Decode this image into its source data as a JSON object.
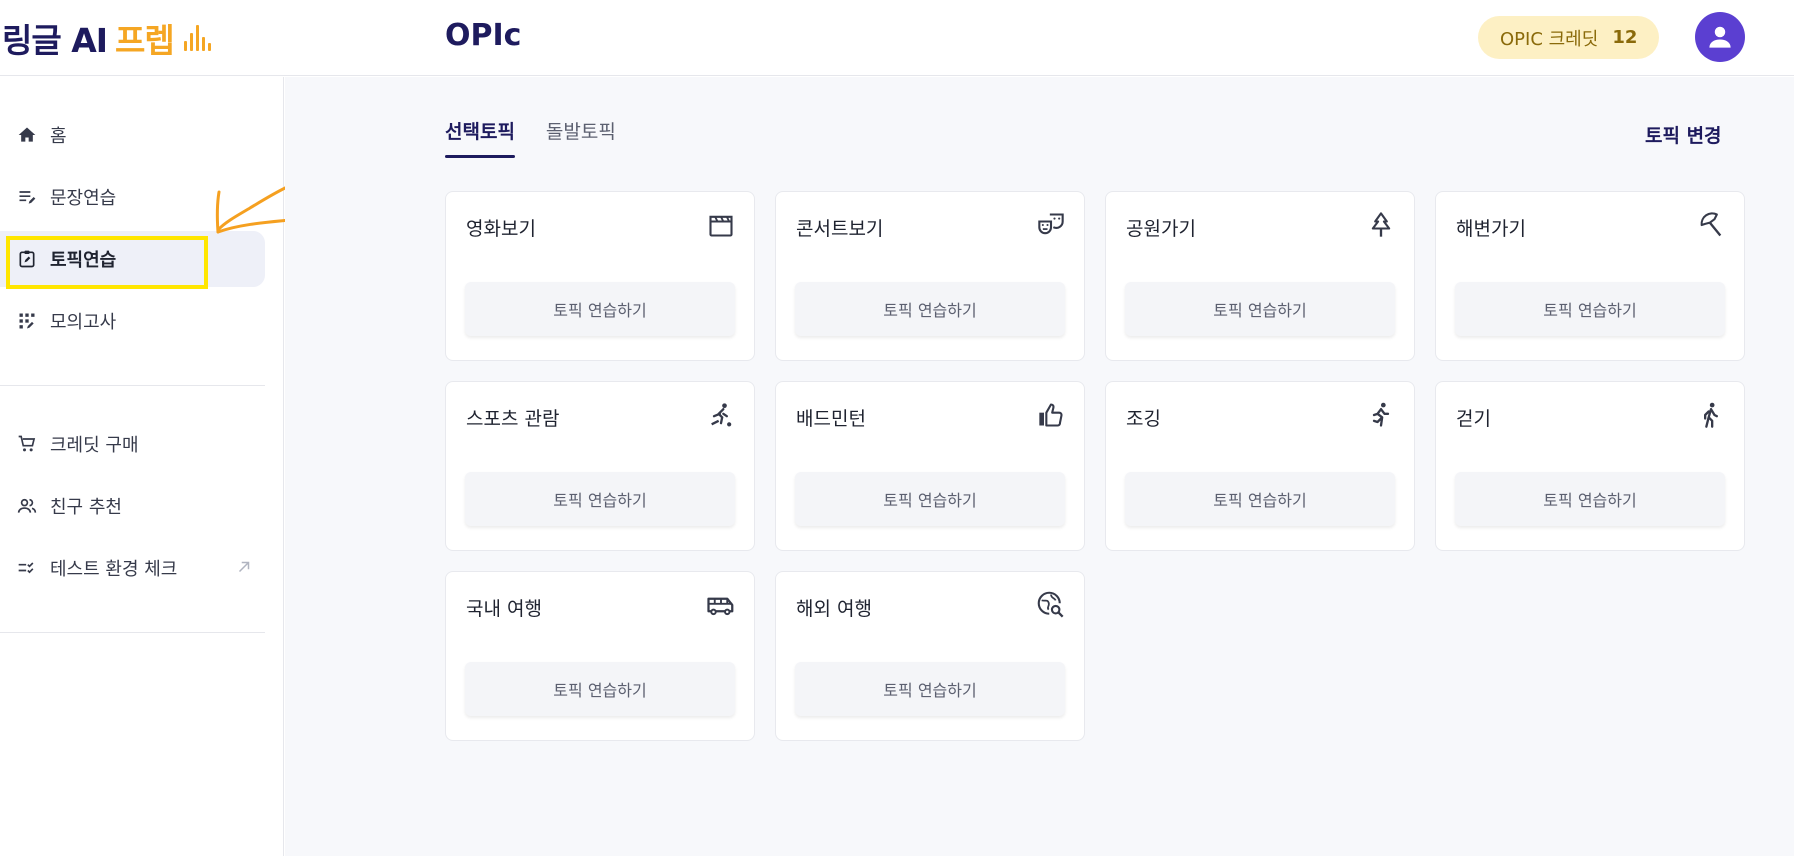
{
  "header": {
    "logo_main": "링글 AI",
    "logo_sub": "프렙",
    "page_title": "OPIc",
    "credit_label": "OPIC 크레딧",
    "credit_count": "12",
    "avatar_icon": "user-icon"
  },
  "sidebar": {
    "items": [
      {
        "label": "홈",
        "icon": "home-icon"
      },
      {
        "label": "문장연습",
        "icon": "edit-list-icon"
      },
      {
        "label": "토픽연습",
        "icon": "clipboard-edit-icon",
        "active": true
      },
      {
        "label": "모의고사",
        "icon": "grid-edit-icon"
      },
      {
        "label": "크레딧 구매",
        "icon": "cart-icon"
      },
      {
        "label": "친구 추천",
        "icon": "people-icon"
      },
      {
        "label": "테스트 환경 체크",
        "icon": "checklist-icon",
        "external_icon": "arrow-up-right-icon"
      }
    ]
  },
  "main": {
    "tabs": [
      {
        "label": "선택토픽",
        "active": true
      },
      {
        "label": "돌발토픽",
        "active": false
      }
    ],
    "topic_change_label": "토픽 변경",
    "cards": [
      {
        "title": "영화보기",
        "icon": "movie-clapper-icon",
        "button": "토픽 연습하기"
      },
      {
        "title": "콘서트보기",
        "icon": "theater-masks-icon",
        "button": "토픽 연습하기"
      },
      {
        "title": "공원가기",
        "icon": "tree-icon",
        "button": "토픽 연습하기"
      },
      {
        "title": "해변가기",
        "icon": "beach-umbrella-icon",
        "button": "토픽 연습하기"
      },
      {
        "title": "스포츠 관람",
        "icon": "sports-hockey-icon",
        "button": "토픽 연습하기"
      },
      {
        "title": "배드민턴",
        "icon": "thumbs-up-icon",
        "button": "토픽 연습하기"
      },
      {
        "title": "조깅",
        "icon": "running-icon",
        "button": "토픽 연습하기"
      },
      {
        "title": "걷기",
        "icon": "walking-icon",
        "button": "토픽 연습하기"
      },
      {
        "title": "국내 여행",
        "icon": "bus-icon",
        "button": "토픽 연습하기"
      },
      {
        "title": "해외 여행",
        "icon": "globe-search-icon",
        "button": "토픽 연습하기"
      }
    ]
  },
  "colors": {
    "brand_navy": "#1e1b5e",
    "brand_orange": "#f5a623",
    "avatar_purple": "#5b3fd1",
    "credit_bg": "#fdf0c4",
    "annotation_yellow": "#ffe600",
    "annotation_orange": "#f5a020"
  }
}
